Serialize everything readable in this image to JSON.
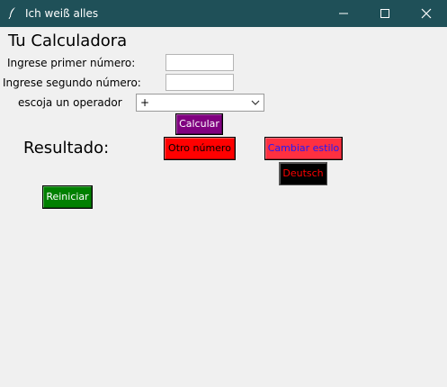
{
  "window": {
    "title": "Ich weiß alles",
    "icon": "feather-icon",
    "controls": [
      "minimize-icon",
      "maximize-icon",
      "close-icon"
    ]
  },
  "app": {
    "heading": "Tu Calculadora",
    "first_label": "Ingrese primer número:",
    "first_value": "",
    "second_label": "Ingrese segundo número:",
    "second_value": "",
    "operator_label": "escoja un operador",
    "operator_selected": "+",
    "calc_button": "Calcular",
    "result_label": "Resultado:",
    "other_number_button": "Otro número",
    "change_style_button": "Cambiar estilo",
    "language_button": "Deutsch",
    "reset_button": "Reiniciar"
  },
  "colors": {
    "titlebar": "#1f5058",
    "calc_bg": "#800080",
    "other_bg": "#ff0000",
    "style_bg": "#ff3040",
    "style_fg": "#1a1aff",
    "lang_bg": "#000000",
    "lang_fg": "#ff0000",
    "reset_bg": "#008000"
  }
}
